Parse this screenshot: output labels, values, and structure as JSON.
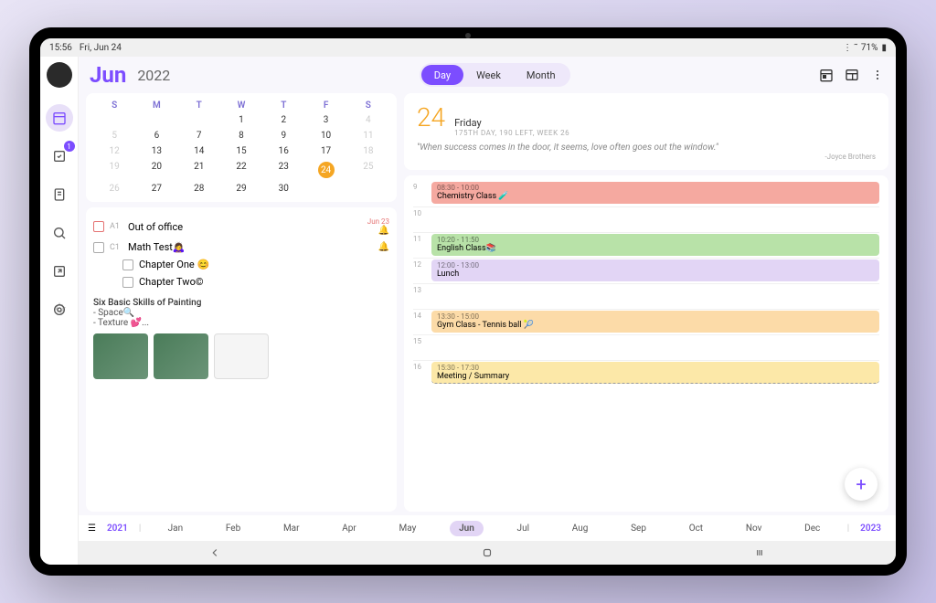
{
  "status": {
    "time": "15:56",
    "date": "Fri, Jun 24",
    "battery": "71%"
  },
  "sidebar": {
    "badge": "1"
  },
  "header": {
    "month": "Jun",
    "year": "2022",
    "views": {
      "day": "Day",
      "week": "Week",
      "month": "Month"
    }
  },
  "calendar": {
    "dow": [
      "S",
      "M",
      "T",
      "W",
      "T",
      "F",
      "S"
    ],
    "rows": [
      [
        "",
        "",
        "",
        "1",
        "2",
        "3",
        "4"
      ],
      [
        "5",
        "6",
        "7",
        "8",
        "9",
        "10",
        "11"
      ],
      [
        "12",
        "13",
        "14",
        "15",
        "16",
        "17",
        "18"
      ],
      [
        "19",
        "20",
        "21",
        "22",
        "23",
        "24",
        "25"
      ],
      [
        "26",
        "27",
        "28",
        "29",
        "30",
        "",
        ""
      ]
    ],
    "dimCol": [
      0,
      6
    ],
    "today": "24"
  },
  "tasks": {
    "t1": {
      "id": "A1",
      "text": "Out of office",
      "date": "Jun 23"
    },
    "t2": {
      "id": "C1",
      "text": "Math Test🙇‍♀️"
    },
    "sub1": "Chapter One 😊",
    "sub2": "Chapter Two©",
    "note_title": "Six Basic Skills of Painting",
    "note_l1": "- Space🔍",
    "note_l2": "- Texture 💕..."
  },
  "day": {
    "num": "24",
    "name": "Friday",
    "info": "175TH DAY, 190 LEFT, WEEK 26",
    "quote": "\"When success comes in the door, it seems, love often goes out the window.\"",
    "author": "-Joyce Brothers"
  },
  "events": [
    {
      "hour": "9",
      "time": "08:30 - 10:00",
      "title": "Chemistry Class 🧪",
      "cls": "ev-red"
    },
    {
      "hour": "10",
      "time": "",
      "title": "",
      "cls": ""
    },
    {
      "hour": "11",
      "time": "10:20 - 11:50",
      "title": "English Class📚",
      "cls": "ev-green"
    },
    {
      "hour": "12",
      "time": "12:00 - 13:00",
      "title": "Lunch",
      "cls": "ev-purple"
    },
    {
      "hour": "13",
      "time": "",
      "title": "",
      "cls": ""
    },
    {
      "hour": "14",
      "time": "13:30 - 15:00",
      "title": "Gym Class - Tennis ball 🎾",
      "cls": "ev-orange"
    },
    {
      "hour": "15",
      "time": "",
      "title": "",
      "cls": ""
    },
    {
      "hour": "16",
      "time": "15:30 - 17:30",
      "title": "Meeting / Summary",
      "cls": "ev-yellow"
    }
  ],
  "strip": {
    "prev": "2021",
    "next": "2023",
    "months": [
      "Jan",
      "Feb",
      "Mar",
      "Apr",
      "May",
      "Jun",
      "Jul",
      "Aug",
      "Sep",
      "Oct",
      "Nov",
      "Dec"
    ],
    "active": "Jun"
  }
}
